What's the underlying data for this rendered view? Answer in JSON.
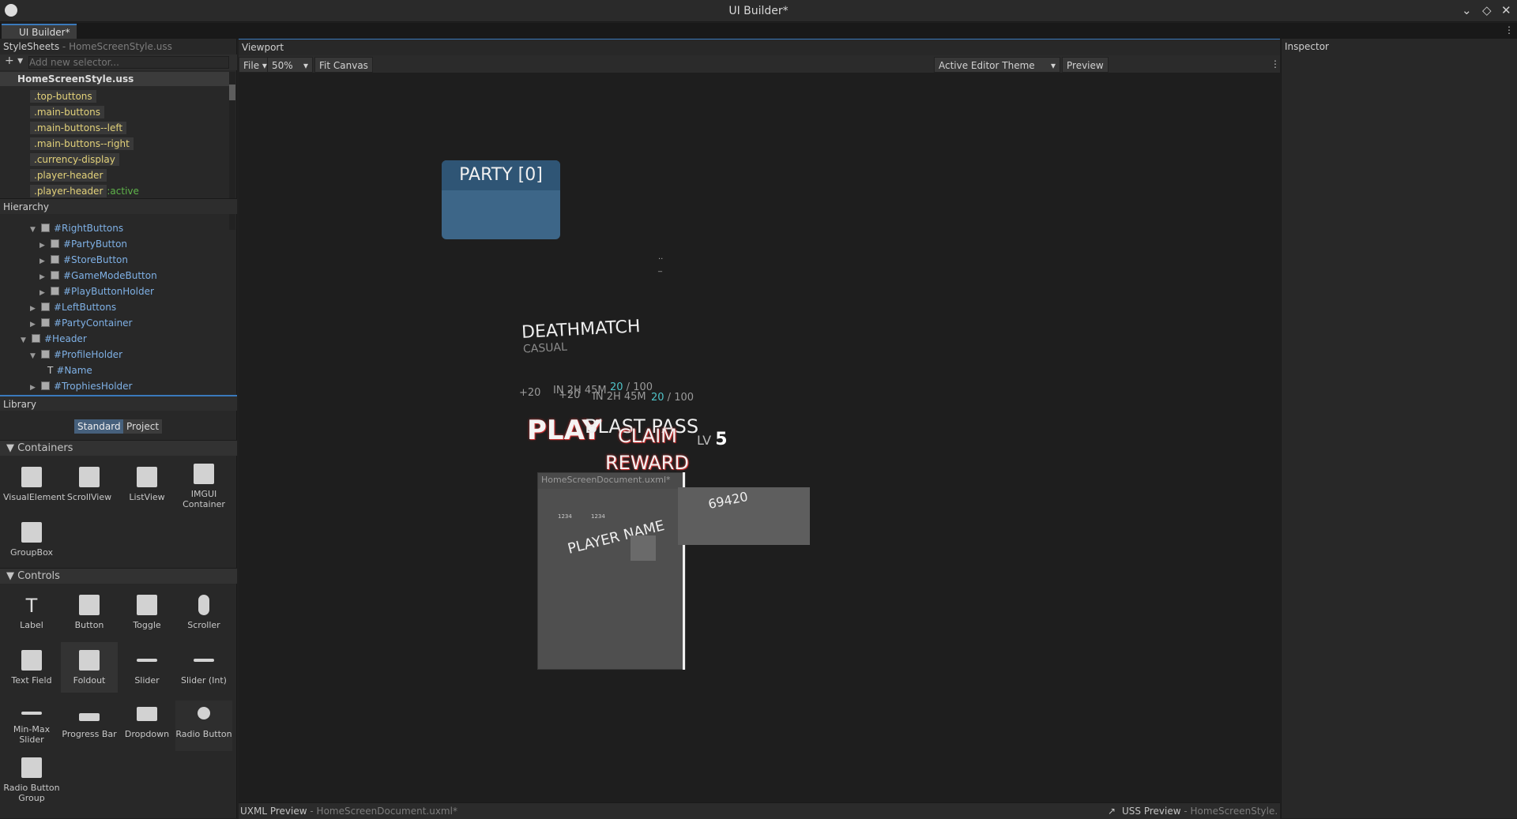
{
  "window": {
    "title": "UI Builder*",
    "tab": "UI Builder*"
  },
  "stylesheets": {
    "header": "StyleSheets",
    "sub": "- HomeScreenStyle.uss",
    "add_placeholder": "Add new selector...",
    "file": "HomeScreenStyle.uss",
    "selectors": [
      ".top-buttons",
      ".main-buttons",
      ".main-buttons--left",
      ".main-buttons--right",
      ".currency-display",
      ".player-header",
      ".player-header"
    ],
    "pseudo": ":active"
  },
  "hierarchy": {
    "header": "Hierarchy",
    "items": [
      "#RightButtons",
      "#PartyButton",
      "#StoreButton",
      "#GameModeButton",
      "#PlayButtonHolder",
      "#LeftButtons",
      "#PartyContainer",
      "#Header",
      "#ProfileHolder",
      "#Name",
      "#TrophiesHolder"
    ]
  },
  "library": {
    "header": "Library",
    "tab_standard": "Standard",
    "tab_project": "Project",
    "containers_label": "Containers",
    "controls_label": "Controls",
    "containers": [
      "VisualElement",
      "ScrollView",
      "ListView",
      "IMGUI Container",
      "GroupBox"
    ],
    "controls": [
      "Label",
      "Button",
      "Toggle",
      "Scroller",
      "Text Field",
      "Foldout",
      "Slider",
      "Slider (Int)",
      "Min-Max Slider",
      "Progress Bar",
      "Dropdown",
      "Radio Button",
      "Radio Button Group"
    ]
  },
  "viewport": {
    "header": "Viewport",
    "file": "File",
    "zoom": "50%",
    "fit": "Fit Canvas",
    "theme": "Active Editor Theme",
    "preview": "Preview"
  },
  "canvas": {
    "party": "PARTY [0]",
    "deathmatch": "DEATHMATCH",
    "casual": "CASUAL",
    "plus20a": "+20",
    "plus20b": "+20",
    "timer_a": "IN 2H 45M",
    "timer_b": "IN 2H 45M",
    "prog_a_num": "20",
    "prog_a_den": " / 100",
    "prog_b_num": "20",
    "prog_b_den": " / 100",
    "play": "PLAY",
    "blastpass": "BLAST PASS",
    "claim": "CLAIM",
    "reward": "REWARD",
    "lv": "LV",
    "lvnum": "5",
    "doc": "HomeScreenDocument.uxml*",
    "playername": "PLAYER NAME",
    "cur1": "1234",
    "cur2": "1234",
    "money": "69420",
    "dots": "..",
    "dash": "_"
  },
  "inspector": {
    "header": "Inspector"
  },
  "footer": {
    "uxml": "UXML Preview",
    "uxml_sub": "- HomeScreenDocument.uxml*",
    "uss": "USS Preview",
    "uss_sub": "- HomeScreenStyle.uss"
  }
}
